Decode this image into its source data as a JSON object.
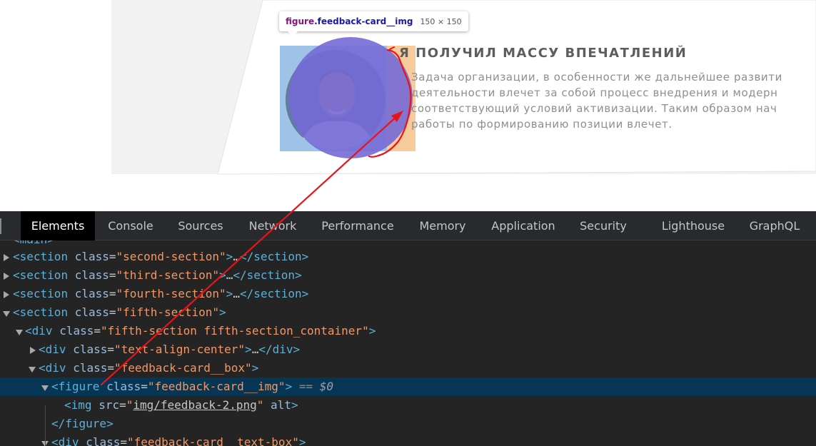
{
  "preview": {
    "tooltip": {
      "selector_tag": "figure",
      "selector_class": ".feedback-card__img",
      "size": "150 × 150"
    },
    "card": {
      "title": "Я ПОЛУЧИЛ МАССУ ВПЕЧАТЛЕНИЙ",
      "text_lines": [
        "Задача организации, в особенности же дальнейшее развити",
        "деятельности влечет за собой процесс внедрения и модерн",
        "соответствующий условий активизации. Таким образом нач",
        "работы по формированию позиции влечет."
      ]
    }
  },
  "devtools": {
    "tabs": [
      "Elements",
      "Console",
      "Sources",
      "Network",
      "Performance",
      "Memory",
      "Application",
      "Security",
      "Lighthouse",
      "GraphQL"
    ],
    "active_tab": "Elements",
    "dom": {
      "partial_top": "<main>",
      "r1": {
        "tag": "section",
        "attr": "class",
        "val": "second-section",
        "ellipsis": "…",
        "close": "</section>"
      },
      "r2": {
        "tag": "section",
        "attr": "class",
        "val": "third-section",
        "ellipsis": "…",
        "close": "</section>"
      },
      "r3": {
        "tag": "section",
        "attr": "class",
        "val": "fourth-section",
        "ellipsis": "…",
        "close": "</section>"
      },
      "r4": {
        "tag": "section",
        "attr": "class",
        "val": "fifth-section"
      },
      "r5": {
        "tag": "div",
        "attr": "class",
        "val": "fifth-section fifth-section_container"
      },
      "r6": {
        "tag": "div",
        "attr": "class",
        "val": "text-align-center",
        "ellipsis": "…",
        "close": "</div>"
      },
      "r7": {
        "tag": "div",
        "attr": "class",
        "val": "feedback-card__box"
      },
      "r8": {
        "tag": "figure",
        "attr": "class",
        "val": "feedback-card__img",
        "eq": "==",
        "ref": "$0"
      },
      "r9": {
        "tag": "img",
        "attr": "src",
        "val": "img/feedback-2.png",
        "attr2": "alt"
      },
      "r10": {
        "close": "</figure>"
      },
      "r11": {
        "tag": "div",
        "attr": "class",
        "val": "feedback-card__text-box"
      }
    }
  },
  "colors": {
    "selected_row": "#073655",
    "annotation_red": "#e8141a",
    "overlay_purple": "#766ad6"
  }
}
